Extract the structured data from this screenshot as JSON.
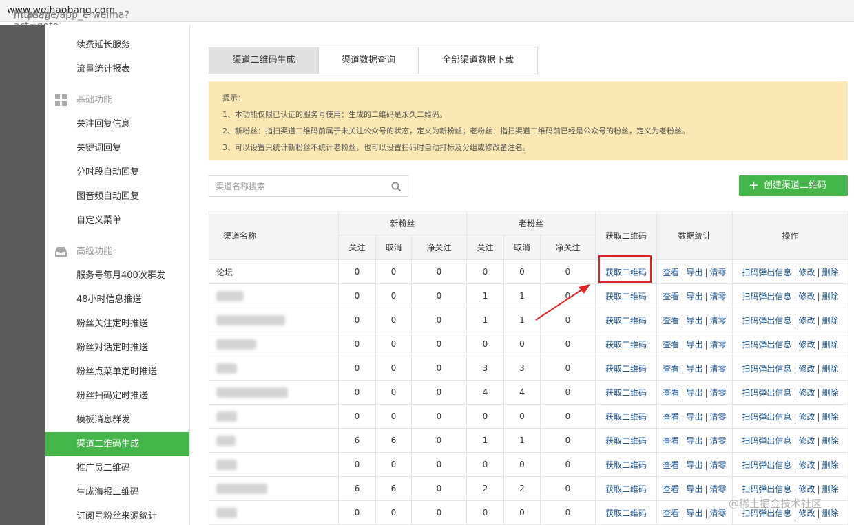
{
  "browser": {
    "url_prefix": "https://",
    "url_domain": "www.weihaobang.com",
    "url_path": "/manage/app_erweima?act=goto"
  },
  "sidebar": {
    "items_top": [
      "续费延长服务",
      "流量统计报表"
    ],
    "section_basic": "基础功能",
    "items_basic": [
      "关注回复信息",
      "关键词回复",
      "分时段自动回复",
      "图音频自动回复",
      "自定义菜单"
    ],
    "section_advanced": "高级功能",
    "items_advanced": [
      "服务号每月400次群发",
      "48小时信息推送",
      "粉丝关注定时推送",
      "粉丝对话定时推送",
      "粉丝点菜单定时推送",
      "粉丝扫码定时推送",
      "模板消息群发",
      "渠道二维码生成",
      "推广员二维码",
      "生成海报二维码",
      "订阅号粉丝来源统计"
    ],
    "active_item": "渠道二维码生成"
  },
  "tabs": [
    "渠道二维码生成",
    "渠道数据查询",
    "全部渠道数据下载"
  ],
  "active_tab": "渠道二维码生成",
  "notice": [
    "提示：",
    "1、本功能仅限已认证的服务号使用：生成的二维码是永久二维码。",
    "2、新粉丝：指扫渠道二维码前属于未关注公众号的状态，定义为新粉丝；老粉丝：指扫渠道二维码前已经是公众号的粉丝，定义为老粉丝。",
    "3、可以设置只统计新粉丝不统计老粉丝，也可以设置扫码时自动打标及分组或修改备注名。"
  ],
  "search": {
    "placeholder": "渠道名称搜索"
  },
  "create_button": "创建渠道二维码",
  "table": {
    "headers": {
      "channel": "渠道名称",
      "new_fans": "新粉丝",
      "old_fans": "老粉丝",
      "get_qr": "获取二维码",
      "stats": "数据统计",
      "ops": "操作"
    },
    "subheaders": [
      "关注",
      "取消",
      "净关注"
    ],
    "actions": {
      "get_qr": "获取二维码",
      "view": "查看",
      "export": "导出",
      "clear": "清零",
      "scan_info": "扫码弹出信息",
      "edit": "修改",
      "delete": "删除"
    },
    "rows": [
      {
        "name": "论坛",
        "blur": 0,
        "new": [
          "0",
          "0",
          "0"
        ],
        "old": [
          "0",
          "0",
          "0"
        ]
      },
      {
        "name": "",
        "blur": 40,
        "new": [
          "0",
          "0",
          "0"
        ],
        "old": [
          "1",
          "1",
          "0"
        ]
      },
      {
        "name": "",
        "blur": 100,
        "new": [
          "0",
          "0",
          "0"
        ],
        "old": [
          "1",
          "1",
          "0"
        ]
      },
      {
        "name": "",
        "blur": 58,
        "new": [
          "0",
          "0",
          "0"
        ],
        "old": [
          "0",
          "0",
          "0"
        ]
      },
      {
        "name": "",
        "blur": 30,
        "new": [
          "0",
          "0",
          "0"
        ],
        "old": [
          "3",
          "3",
          "0"
        ]
      },
      {
        "name": "",
        "blur": 104,
        "new": [
          "0",
          "0",
          "0"
        ],
        "old": [
          "4",
          "4",
          "0"
        ]
      },
      {
        "name": "",
        "blur": 30,
        "new": [
          "0",
          "0",
          "0"
        ],
        "old": [
          "0",
          "0",
          "0"
        ]
      },
      {
        "name": "",
        "blur": 28,
        "new": [
          "6",
          "6",
          "0"
        ],
        "old": [
          "1",
          "1",
          "0"
        ]
      },
      {
        "name": "",
        "blur": 30,
        "new": [
          "0",
          "0",
          "0"
        ],
        "old": [
          "0",
          "0",
          "0"
        ]
      },
      {
        "name": "",
        "blur": 74,
        "new": [
          "6",
          "6",
          "0"
        ],
        "old": [
          "2",
          "2",
          "0"
        ]
      },
      {
        "name": "",
        "blur": 30,
        "new": [
          "0",
          "0",
          "0"
        ],
        "old": [
          "0",
          "0",
          "0"
        ]
      }
    ]
  },
  "watermark": "@稀土掘金技术社区",
  "colors": {
    "accent_green": "#44b549",
    "link_blue": "#1e5494",
    "notice_bg": "#fbe8b4",
    "highlight_red": "#e02424"
  }
}
